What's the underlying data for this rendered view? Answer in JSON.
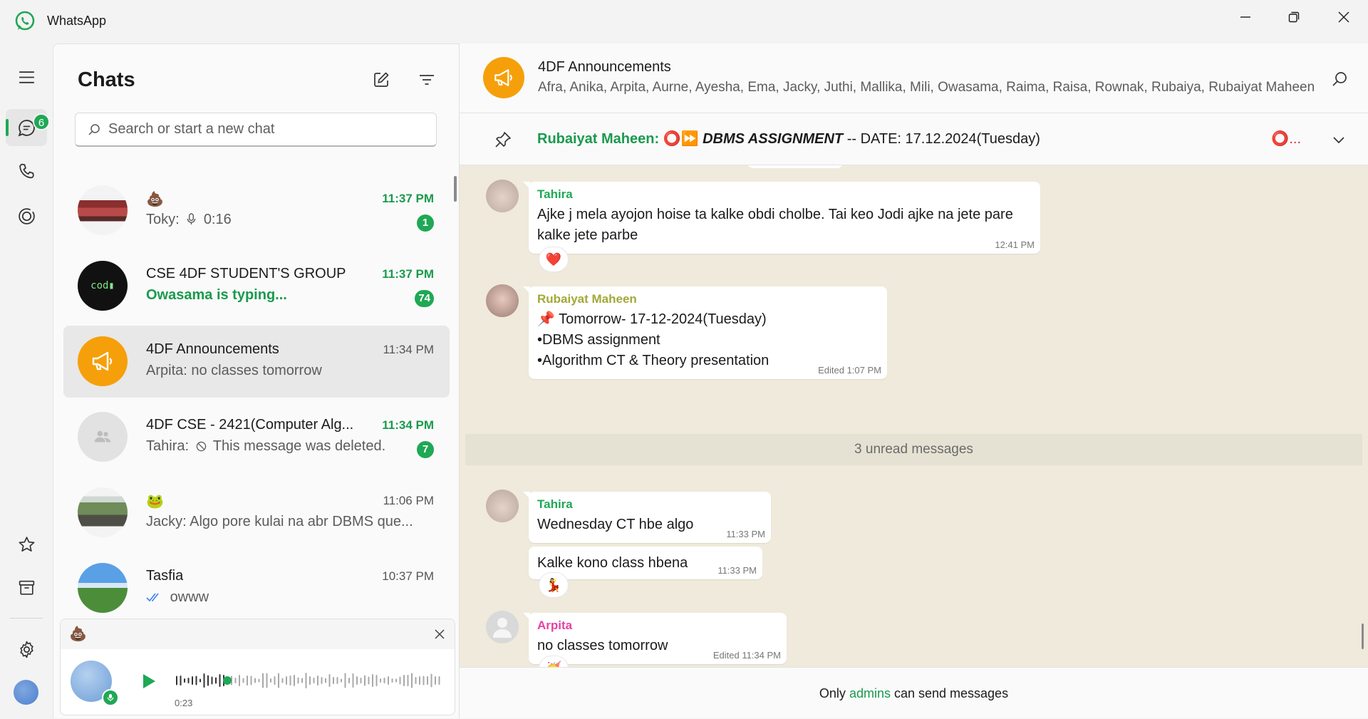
{
  "app": {
    "title": "WhatsApp",
    "brand_color": "#25D366",
    "accent": "#1FA855"
  },
  "rail": {
    "chats_badge": "6"
  },
  "chatlist": {
    "title": "Chats",
    "search_placeholder": "Search or start a new chat",
    "chats": [
      {
        "name": "💩",
        "preview_sender": "Toky:",
        "preview_text": "0:16",
        "time": "11:37 PM",
        "unread": "1"
      },
      {
        "name": "CSE 4DF STUDENT'S GROUP",
        "preview_text": "Owasama is typing...",
        "time": "11:37 PM",
        "unread": "74"
      },
      {
        "name": "4DF Announcements",
        "preview_text": "Arpita: no classes tomorrow",
        "time": "11:34 PM"
      },
      {
        "name": "4DF CSE - 2421(Computer Alg...",
        "preview_sender": "Tahira:",
        "preview_text": "This message was deleted.",
        "time": "11:34 PM",
        "unread": "7"
      },
      {
        "name": "🐸",
        "preview_text": "Jacky: Algo pore kulai na abr DBMS que...",
        "time": "11:06 PM"
      },
      {
        "name": "Tasfia",
        "preview_text": "owww",
        "time": "10:37 PM"
      }
    ]
  },
  "voice_player": {
    "chat_emoji": "💩",
    "duration": "0:23"
  },
  "conversation": {
    "name": "4DF Announcements",
    "members": "Afra, Anika, Arpita, Aurne, Ayesha, Ema, Jacky, Juthi, Mallika, Mili, Owasama, Raima, Raisa, Rownak, Rubaiya, Rubaiyat Maheen",
    "pinned": {
      "author": "Rubaiyat Maheen:",
      "emojis": "⭕⏩",
      "title": "DBMS ASSIGNMENT",
      "rest": " -- DATE: 17.12.2024(Tuesday)",
      "more": "⭕..."
    },
    "messages": [
      {
        "sender": "Tahira",
        "sender_color": "#1FA855",
        "lines": [
          "Ajke j mela ayojon hoise ta kalke obdi cholbe. Tai keo Jodi ajke na jete pare",
          "kalke jete parbe"
        ],
        "time": "12:41 PM",
        "reaction": "❤️"
      },
      {
        "sender": "Rubaiyat Maheen",
        "sender_color": "#A3A837",
        "lines": [
          "📌 Tomorrow- 17-12-2024(Tuesday)",
          "•DBMS assignment",
          "•Algorithm CT & Theory presentation"
        ],
        "time": "Edited 1:07 PM"
      },
      {
        "sender": "Tahira",
        "sender_color": "#1FA855",
        "lines": [
          "Wednesday CT hbe algo"
        ],
        "time": "11:33 PM"
      },
      {
        "lines": [
          "Kalke kono class hbena"
        ],
        "time": "11:33 PM",
        "reaction": "💃"
      },
      {
        "sender": "Arpita",
        "sender_color": "#E542A3",
        "lines": [
          "no classes tomorrow"
        ],
        "time": "Edited 11:34 PM",
        "reaction": "🥳"
      }
    ],
    "unread_divider": "3 unread messages",
    "footer": {
      "before": "Only ",
      "admins": "admins",
      "after": " can send messages"
    }
  }
}
